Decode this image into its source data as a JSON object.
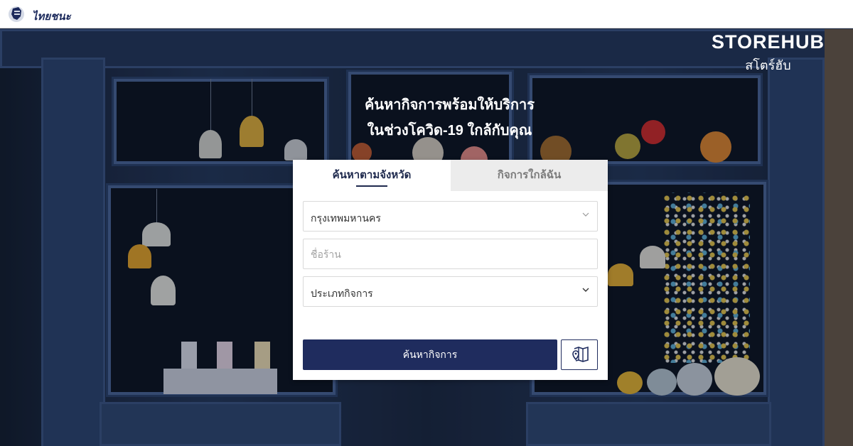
{
  "header": {
    "brand": "ไทยชนะ",
    "logo_icon": "fist-icon"
  },
  "hero": {
    "logo_en": "STOREHUB",
    "logo_th": "สโตร์ฮับ",
    "headline_line1": "ค้นหากิจการพร้อมให้บริการ",
    "headline_line2": "ในช่วงโควิด-19 ใกล้กับคุณ"
  },
  "search": {
    "tabs": [
      {
        "label": "ค้นหาตามจังหวัด",
        "active": true
      },
      {
        "label": "กิจการใกล้ฉัน",
        "active": false
      }
    ],
    "province": {
      "value": "กรุงเทพมหานคร",
      "icon": "chevron-down-icon"
    },
    "store_name": {
      "placeholder": "ชื่อร้าน"
    },
    "business_type": {
      "value": "ประเภทกิจการ",
      "icon": "chevron-down-icon"
    },
    "submit_label": "ค้นหากิจการ",
    "map_icon": "map-pin-icon"
  },
  "colors": {
    "primary": "#1f2c5e",
    "tab_inactive_bg": "#ececec",
    "text_muted": "#a2a2a2"
  }
}
